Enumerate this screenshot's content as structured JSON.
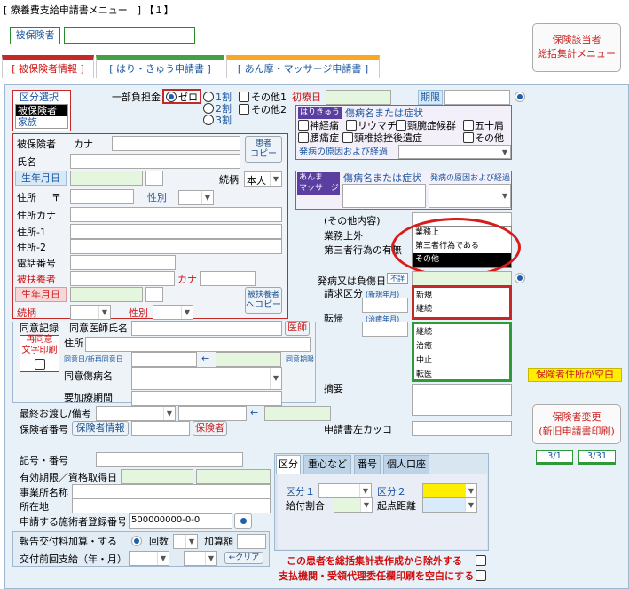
{
  "title": "[ 療養費支給申請書メニュー　] 【１】",
  "hihoken_btn": "被保険者",
  "top_right_btn": [
    "保険該当者",
    "総括集計メニュー"
  ],
  "tabs": [
    "[ 被保険者情報 ]",
    "[ はり・きゅう申請書 ]",
    "[ あん摩・マッサージ申請書 ]"
  ],
  "kubun": {
    "title": "区分選択",
    "items": [
      "被保険者",
      "家族"
    ]
  },
  "ichibu": {
    "label": "一部負担金",
    "opts": [
      "ゼロ",
      "1割",
      "2割",
      "3割"
    ],
    "checks": [
      "その他1",
      "その他2"
    ]
  },
  "shoshin": "初療日",
  "kigen": "期限",
  "hari": {
    "tag": "はりきゅう",
    "title": "傷病名または症状",
    "items": [
      "神経痛",
      "リウマチ",
      "頸腕症候群",
      "五十肩",
      "腰痛症",
      "頸椎捻挫後遺症",
      "その他"
    ],
    "cause": "発病の原因および経過"
  },
  "anma": {
    "tag": "あんま\nマッサージ",
    "title": "傷病名または症状",
    "cause": "発病の原因および経過"
  },
  "left": {
    "hihoken": "被保険者",
    "kana": "カナ",
    "shimei": "氏名",
    "birth": "生年月日",
    "zokugara": "続柄",
    "zokugara_val": "本人",
    "jusho": "住所",
    "yubin": "〒",
    "seibetsu": "性別",
    "jusho_kana": "住所カナ",
    "jusho1": "住所-1",
    "jusho2": "住所-2",
    "denwa": "電話番号",
    "fuyo": "被扶養者",
    "fkana": "カナ",
    "fbirth": "生年月日",
    "fzoku": "続柄",
    "fsex": "性別",
    "copy1": [
      "患者",
      "コピー"
    ],
    "copy2": [
      "被扶養者",
      "へコピー"
    ]
  },
  "mid": {
    "sonota": "(その他内容)",
    "gyomu": "業務上外",
    "daisan": "第三者行為の有無",
    "hatsubyo": "発病又は負傷日",
    "fumei": "不詳",
    "seikyu": "請求区分",
    "seikyu_note": "(新規年月)",
    "tenki": "転帰",
    "tenki_note": "(治癒年月)",
    "tekiyo": "摘要"
  },
  "popup": [
    "業務上",
    "第三者行為である",
    "その他"
  ],
  "seikyu_list": [
    "新規",
    "継続"
  ],
  "tenki_list": [
    "継続",
    "治癒",
    "中止",
    "転医"
  ],
  "doui": {
    "kiroku": "同意記録",
    "ishi": "同意医師氏名",
    "ishi_btn": "医師",
    "saimoji": "再同意\n文字印刷",
    "jusho": "住所",
    "dates": "同意日/新再同意日",
    "kigen": "同意期限",
    "shobyo": "同意傷病名",
    "kaigo": "要加療期間"
  },
  "saishu": "最終お渡し/備考",
  "hokensha": {
    "label": "保険者番号",
    "info": "保険者情報",
    "btn": "保険者"
  },
  "migi": "申請書左カッコ",
  "kuuhaku": "保険者住所が空白",
  "henko": [
    "保険者変更",
    "(新旧申請書印刷)"
  ],
  "pages": [
    "3/1",
    "3/31"
  ],
  "bottom": {
    "kigo": "記号・番号",
    "yuko": "有効期限／資格取得日",
    "jigyo": "事業所名称",
    "shozai": "所在地",
    "toroku": "申請する施術者登録番号",
    "toroku_val": "500000000-0-0",
    "hokoku": "報告交付料加算・する",
    "kaisu": "回数",
    "kasan": "加算額",
    "kofu": "交付前回支給（年・月）",
    "clear": "←クリア"
  },
  "subtabs": [
    "区分",
    "重心など",
    "番号",
    "個人口座"
  ],
  "kubun1": "区分１",
  "kubun2": "区分２",
  "kyufu": "給付割合",
  "kiten": "起点距離",
  "exclude1": "この患者を総括集計表作成から除外する",
  "exclude2": "支払機関・受領代理委任欄印刷を空白にする"
}
